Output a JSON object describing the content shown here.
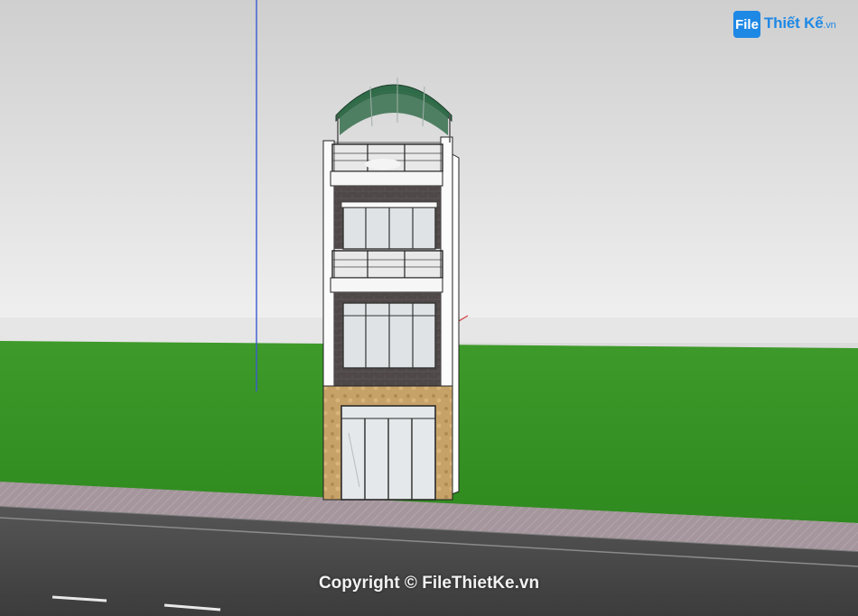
{
  "watermark": {
    "logo_mark": "File",
    "logo_name": "Thiết Kế",
    "logo_domain": ".vn",
    "copyright": "Copyright © FileThietKe.vn"
  },
  "colors": {
    "sky": "#e4e4e4",
    "grass": "#3f9a2a",
    "sidewalk": "#a89aa0",
    "road": "#4c4c4c",
    "roof": "#2f6b48",
    "facade_white": "#f4f4f4",
    "brick": "#5a5050",
    "stone": "#c7a268",
    "logo_blue": "#1e88e5"
  },
  "scene": {
    "subject": "three-storey-townhouse-3d-model",
    "icon_names": [
      "axis-line-icon",
      "arched-roof-icon",
      "glass-door-icon",
      "balcony-railing-icon"
    ]
  }
}
